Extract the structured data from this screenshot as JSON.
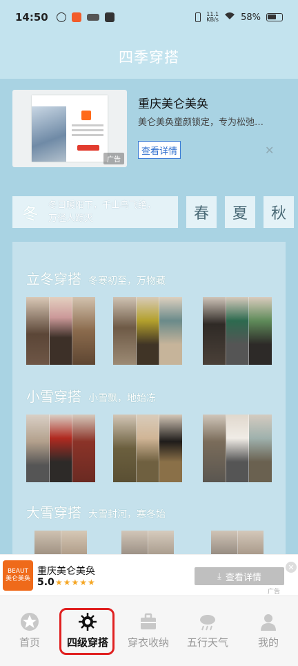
{
  "status_bar": {
    "time": "14:50",
    "net_speed_top": "11.1",
    "net_speed_bottom": "KB/s",
    "battery": "58%",
    "icons": [
      "app-icon",
      "app-icon",
      "app-icon",
      "app-icon",
      "vibrate-icon",
      "wifi-icon",
      "battery-icon"
    ]
  },
  "header": {
    "title": "四季穿搭"
  },
  "top_ad": {
    "title": "重庆美仑美奂",
    "description": "美仑美奂童颜锁定，专为松弛…",
    "button": "查看详情",
    "tag": "广告"
  },
  "seasons": {
    "current": "冬",
    "current_poem_line1": "冬日暖阳下，千山鸟飞绝，",
    "current_poem_line2": "万径人踪灭",
    "tabs": [
      "春",
      "夏",
      "秋"
    ]
  },
  "sections": [
    {
      "title": "立冬穿搭",
      "subtitle": "冬寒初至，万物藏"
    },
    {
      "title": "小雪穿搭",
      "subtitle": "小雪飘，地始冻"
    },
    {
      "title": "大雪穿搭",
      "subtitle": "大雪封河，寒冬始"
    }
  ],
  "bottom_ad": {
    "logo_line1": "BEAUT",
    "logo_line2": "美仑美奂",
    "app_name": "重庆美仑美奂",
    "rating": "5.0",
    "button": "查看详情",
    "tag": "广告"
  },
  "tab_bar": [
    {
      "label": "首页",
      "icon": "star-icon"
    },
    {
      "label": "四级穿搭",
      "icon": "snowflake-sun-icon"
    },
    {
      "label": "穿衣收纳",
      "icon": "suitcase-icon"
    },
    {
      "label": "五行天气",
      "icon": "rain-cloud-icon"
    },
    {
      "label": "我的",
      "icon": "user-icon"
    }
  ],
  "colors": {
    "page_bg": "#c3e3ee",
    "content_bg": "#a9d3e3",
    "highlight": "#e02020",
    "ad_button": "#3a7bd5"
  }
}
